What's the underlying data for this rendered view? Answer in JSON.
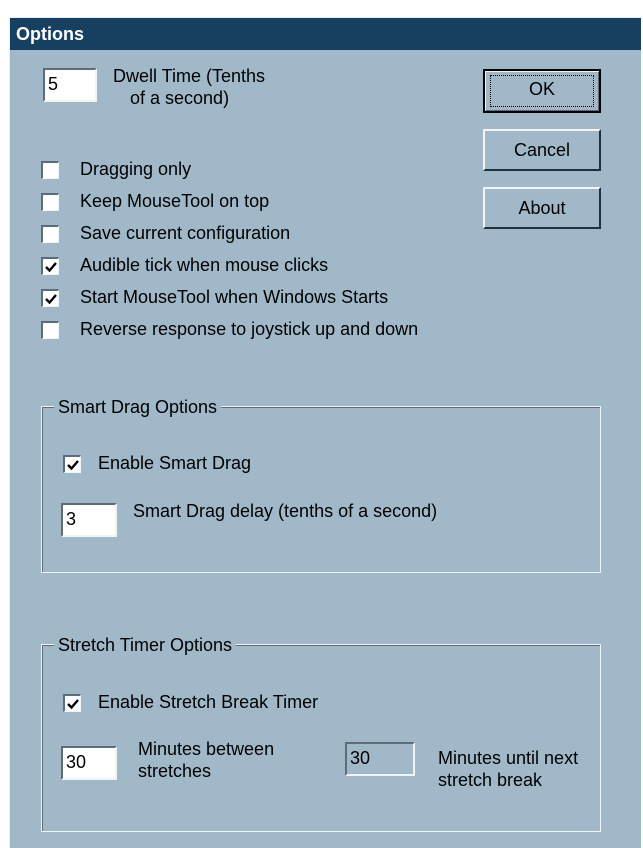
{
  "window": {
    "title": "Options"
  },
  "dwell": {
    "value": "5",
    "label_line1": "Dwell Time (Tenths",
    "label_line2": "of a second)"
  },
  "buttons": {
    "ok": "OK",
    "cancel": "Cancel",
    "about": "About"
  },
  "options": [
    {
      "label": "Dragging only",
      "checked": false
    },
    {
      "label": "Keep MouseTool on top",
      "checked": false
    },
    {
      "label": "Save current configuration",
      "checked": false
    },
    {
      "label": "Audible tick when mouse clicks",
      "checked": true
    },
    {
      "label": "Start MouseTool when Windows Starts",
      "checked": true
    },
    {
      "label": "Reverse response to joystick up and down",
      "checked": false
    }
  ],
  "smart_drag": {
    "legend": "Smart Drag Options",
    "enable_label": "Enable Smart Drag",
    "enable_checked": true,
    "delay_value": "3",
    "delay_label": "Smart Drag delay (tenths of a second)"
  },
  "stretch": {
    "legend": "Stretch Timer Options",
    "enable_label": "Enable Stretch Break Timer",
    "enable_checked": true,
    "between_value": "30",
    "between_label_line1": "Minutes between",
    "between_label_line2": "stretches",
    "until_value": "30",
    "until_label_line1": "Minutes until next",
    "until_label_line2": "stretch break"
  }
}
